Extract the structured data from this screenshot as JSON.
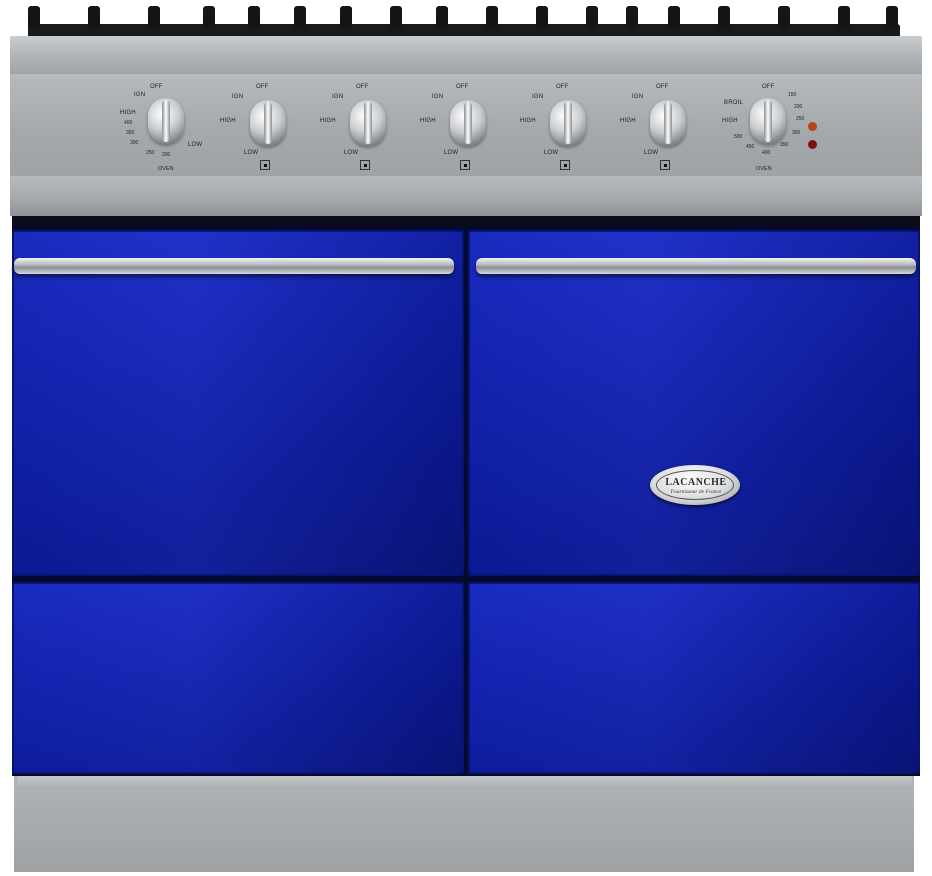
{
  "appliance": {
    "type": "range cooker",
    "color_accent": "#1424b8",
    "steel_color": "#a9acae"
  },
  "controls": {
    "burner_knobs": [
      {
        "off": "OFF",
        "ign": "IGN",
        "high": "HIGH",
        "low": "LOW"
      },
      {
        "off": "OFF",
        "ign": "IGN",
        "high": "HIGH",
        "low": "LOW"
      },
      {
        "off": "OFF",
        "ign": "IGN",
        "high": "HIGH",
        "low": "LOW"
      },
      {
        "off": "OFF",
        "ign": "IGN",
        "high": "HIGH",
        "low": "LOW"
      },
      {
        "off": "OFF",
        "ign": "IGN",
        "high": "HIGH",
        "low": "LOW"
      }
    ],
    "left_oven_knob": {
      "off": "OFF",
      "ign": "IGN",
      "high": "HIGH",
      "low": "LOW",
      "oven": "OVEN",
      "scale": [
        "400",
        "350",
        "300",
        "250",
        "200"
      ]
    },
    "right_oven_knob": {
      "off": "OFF",
      "broil": "BROIL",
      "high": "HIGH",
      "oven": "OVEN",
      "scale": [
        "150",
        "200",
        "250",
        "300",
        "350",
        "400",
        "450",
        "500"
      ]
    },
    "lamps": [
      "#b4441a",
      "#7a1010"
    ]
  },
  "badge": {
    "brand": "LACANCHE",
    "tagline": "Fournisseur de France"
  }
}
